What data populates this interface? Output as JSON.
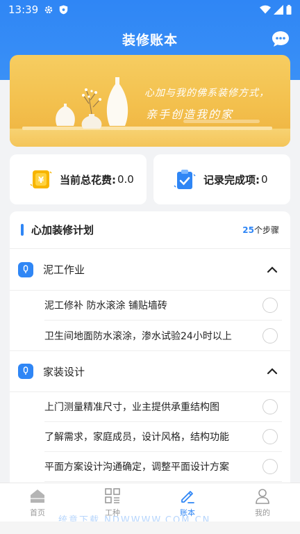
{
  "status": {
    "time": "13:39"
  },
  "app": {
    "title": "装修账本"
  },
  "banner": {
    "line1": "心加与我的佛系装修方式，",
    "line2": "亲手创造我的家"
  },
  "stats": {
    "spend_label": "当前总花费:",
    "spend_value": "0.0",
    "records_label": "记录完成项:",
    "records_value": "0"
  },
  "plan": {
    "title": "心加装修计划",
    "count": "25",
    "count_unit": "个步骤",
    "groups": [
      {
        "title": "泥工作业",
        "tasks": [
          "泥工修补 防水滚涂 铺贴墙砖",
          "卫生间地面防水滚涂，渗水试验24小时以上"
        ]
      },
      {
        "title": "家装设计",
        "tasks": [
          "上门测量精准尺寸，业主提供承重结构图",
          "了解需求，家庭成员，设计风格，结构功能",
          "平面方案设计沟通确定，调整平面设计方案"
        ]
      }
    ]
  },
  "tabs": [
    {
      "label": "首页",
      "icon": "home-icon"
    },
    {
      "label": "工种",
      "icon": "grid-list-icon"
    },
    {
      "label": "账本",
      "icon": "edit-pen-icon",
      "active": true
    },
    {
      "label": "我的",
      "icon": "user-icon"
    }
  ],
  "watermark": "统意下载 NDWWWW.COM.CN",
  "colors": {
    "accent": "#2f86f5",
    "banner": "#f3c04d"
  }
}
